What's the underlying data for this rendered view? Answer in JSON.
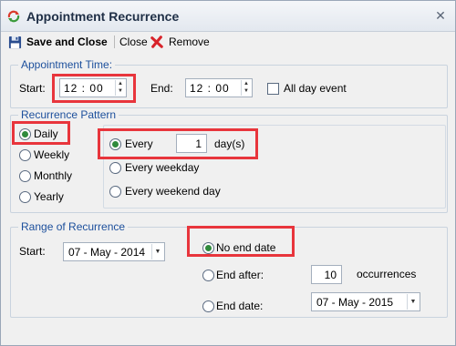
{
  "window": {
    "title": "Appointment Recurrence",
    "close_glyph": "✕"
  },
  "toolbar": {
    "save_label": "Save and Close",
    "close_label": "Close",
    "remove_label": "Remove"
  },
  "appointment_time": {
    "legend": "Appointment Time:",
    "start_label": "Start:",
    "start_value": "12 : 00",
    "end_label": "End:",
    "end_value": "12 : 00",
    "all_day_label": "All day event",
    "all_day_checked": false
  },
  "pattern": {
    "legend": "Recurrence Pattern",
    "options": [
      {
        "label": "Daily",
        "selected": true
      },
      {
        "label": "Weekly",
        "selected": false
      },
      {
        "label": "Monthly",
        "selected": false
      },
      {
        "label": "Yearly",
        "selected": false
      }
    ],
    "daily": {
      "every_label": "Every",
      "every_value": "1",
      "unit_label": "day(s)",
      "weekday_label": "Every weekday",
      "weekend_label": "Every weekend day"
    }
  },
  "range": {
    "legend": "Range of Recurrence",
    "start_label": "Start:",
    "start_value": "07 - May - 2014",
    "no_end_label": "No end date",
    "end_after_label": "End after:",
    "end_after_value": "10",
    "occurrences_label": "occurrences",
    "end_date_label": "End date:",
    "end_date_value": "07 - May - 2015"
  },
  "icons": {
    "app": "appointment-recurrence-icon",
    "save": "floppy-disk-icon",
    "remove": "red-x-icon",
    "spin_up": "▲",
    "spin_down": "▼",
    "dropdown": "▼"
  }
}
